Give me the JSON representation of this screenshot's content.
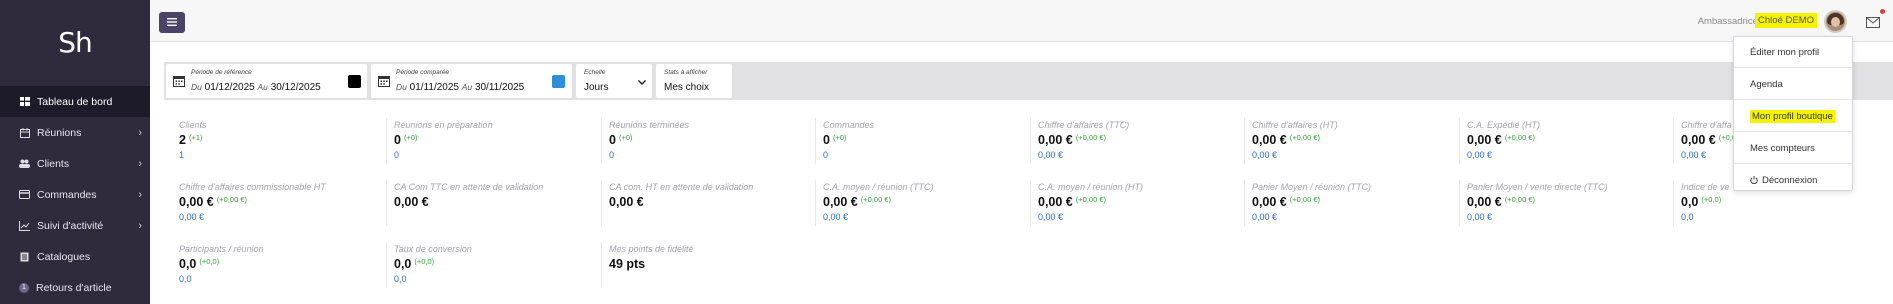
{
  "brand": {
    "logo_text": "Sh"
  },
  "sidebar": {
    "items": [
      {
        "label": "Tableau de bord",
        "icon": "dashboard-icon",
        "active": true,
        "has_chevron": false
      },
      {
        "label": "Réunions",
        "icon": "calendar-icon",
        "active": false,
        "has_chevron": true
      },
      {
        "label": "Clients",
        "icon": "users-icon",
        "active": false,
        "has_chevron": true
      },
      {
        "label": "Commandes",
        "icon": "card-icon",
        "active": false,
        "has_chevron": true
      },
      {
        "label": "Suivi d'activité",
        "icon": "chart-icon",
        "active": false,
        "has_chevron": true
      },
      {
        "label": "Catalogues",
        "icon": "catalog-icon",
        "active": false,
        "has_chevron": false
      },
      {
        "label": "Retours d'article",
        "icon": "badge-icon",
        "badge": "1",
        "active": false,
        "has_chevron": false
      }
    ]
  },
  "topbar": {
    "role": "Ambassadrice |",
    "username": "Chloé DEMO",
    "highlight_color": "#f5f200"
  },
  "filters": {
    "reference": {
      "label": "Période de référence",
      "du": "Du",
      "start": "01/12/2025",
      "au": "Au",
      "end": "30/12/2025",
      "color": "#000000"
    },
    "compare": {
      "label": "Période comparée",
      "du": "Du",
      "start": "01/11/2025",
      "au": "Au",
      "end": "30/11/2025",
      "color": "#2f8fd6"
    },
    "scale": {
      "label": "Echelle",
      "value": "Jours"
    },
    "stats": {
      "label": "Stats à afficher",
      "value": "Mes choix"
    }
  },
  "stats": [
    {
      "label": "Clients",
      "value": "2",
      "delta": "(+1)",
      "sub": "1"
    },
    {
      "label": "Réunions en préparation",
      "value": "0",
      "delta": "(+0)",
      "sub": "0"
    },
    {
      "label": "Réunions terminées",
      "value": "0",
      "delta": "(+0)",
      "sub": "0"
    },
    {
      "label": "Commandes",
      "value": "0",
      "delta": "(+0)",
      "sub": "0"
    },
    {
      "label": "Chiffre d'affaires (TTC)",
      "value": "0,00 €",
      "delta": "(+0,00 €)",
      "sub": "0,00 €"
    },
    {
      "label": "Chiffre d'affaires (HT)",
      "value": "0,00 €",
      "delta": "(+0,00 €)",
      "sub": "0,00 €"
    },
    {
      "label": "C.A. Expédié (HT)",
      "value": "0,00 €",
      "delta": "(+0,00 €)",
      "sub": "0,00 €"
    },
    {
      "label": "Chiffre d'affa",
      "value": "0,00 €",
      "delta": "(+0,00 €)",
      "sub": "0,00 €"
    },
    {
      "label": "Chiffre d'affaires commissionable HT",
      "value": "0,00 €",
      "delta": "(+0,00 €)",
      "sub": "0,00 €"
    },
    {
      "label": "CA Com TTC en attente de validation",
      "value": "0,00 €",
      "delta": "",
      "sub": ""
    },
    {
      "label": "CA com. HT en attente de validation",
      "value": "0,00 €",
      "delta": "",
      "sub": ""
    },
    {
      "label": "C.A. moyen / réunion (TTC)",
      "value": "0,00 €",
      "delta": "(+0,00 €)",
      "sub": "0,00 €"
    },
    {
      "label": "C.A. moyen / réunion (HT)",
      "value": "0,00 €",
      "delta": "(+0,00 €)",
      "sub": "0,00 €"
    },
    {
      "label": "Panier Moyen / réunion (TTC)",
      "value": "0,00 €",
      "delta": "(+0,00 €)",
      "sub": "0,00 €"
    },
    {
      "label": "Panier Moyen / vente directe (TTC)",
      "value": "0,00 €",
      "delta": "(+0,00 €)",
      "sub": "0,00 €"
    },
    {
      "label": "Indice de ve",
      "value": "0,0",
      "delta": "(+0,0)",
      "sub": "0,0"
    },
    {
      "label": "Participants / réunion",
      "value": "0,0",
      "delta": "(+0,0)",
      "sub": "0,0"
    },
    {
      "label": "Taux de conversion",
      "value": "0,0",
      "delta": "(+0,0)",
      "sub": "0,0"
    },
    {
      "label": "Mes points de fidélité",
      "value": "49 pts",
      "delta": "",
      "sub": ""
    }
  ],
  "profile_menu": {
    "items": [
      {
        "label": "Éditer mon profil",
        "highlight": false
      },
      {
        "label": "Agenda",
        "highlight": false
      },
      {
        "label": "Mon profil boutique",
        "highlight": true
      },
      {
        "label": "Mes compteurs",
        "highlight": false
      },
      {
        "label": "Déconnexion",
        "highlight": false,
        "icon": "power-icon"
      }
    ]
  }
}
